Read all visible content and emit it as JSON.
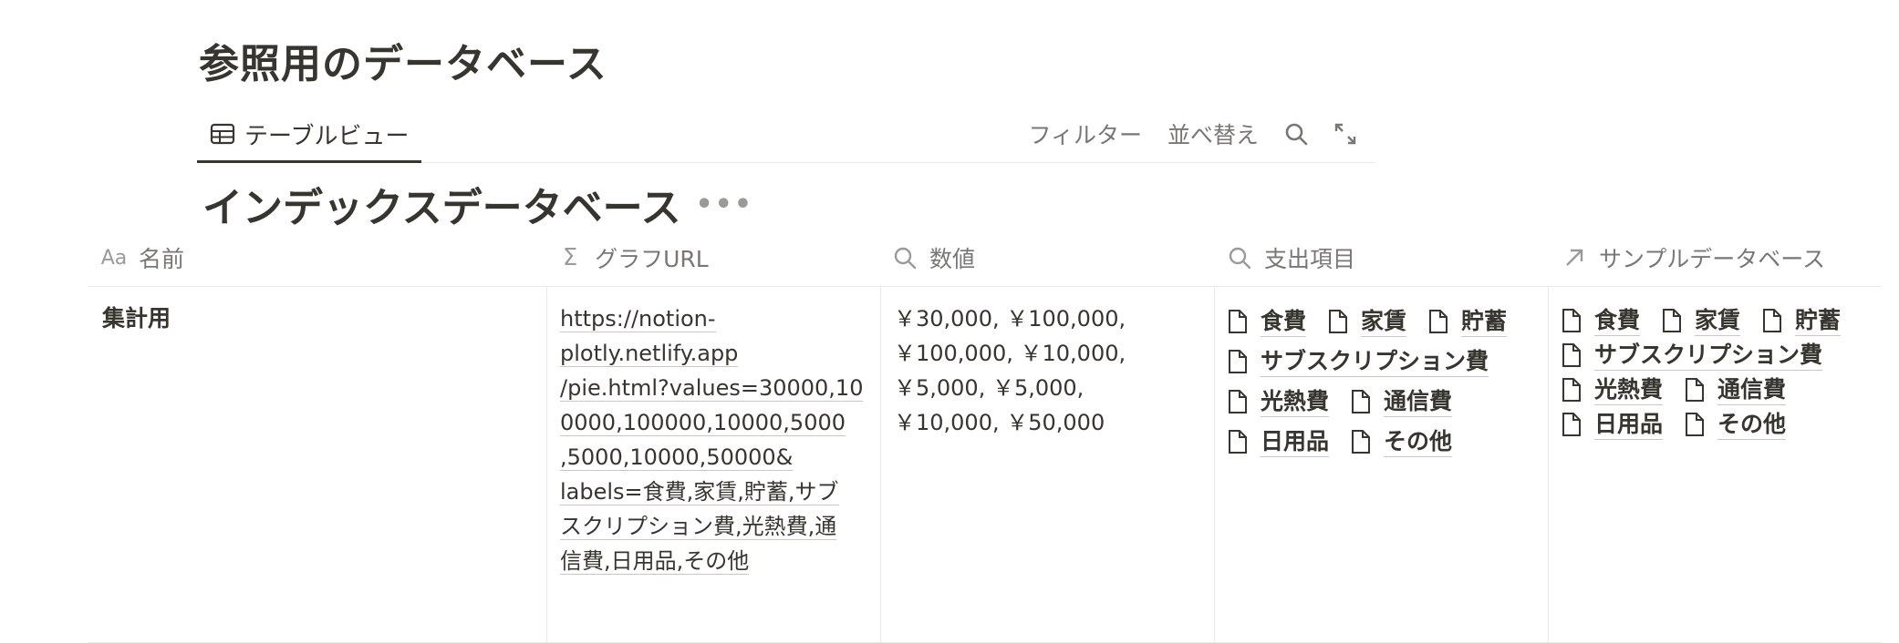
{
  "page": {
    "title": "参照用のデータベース"
  },
  "view": {
    "tab_label": "テーブルビュー",
    "filter_label": "フィルター",
    "sort_label": "並べ替え"
  },
  "database": {
    "title": "インデックスデータベース",
    "more": "•••",
    "columns": [
      {
        "label": "名前",
        "icon": "Aa"
      },
      {
        "label": "グラフURL",
        "icon": "Σ"
      },
      {
        "label": "数値",
        "icon": "search-icon"
      },
      {
        "label": "支出項目",
        "icon": "search-icon"
      },
      {
        "label": "サンプルデータベース",
        "icon": "arrow-up-right-icon"
      }
    ],
    "rows": [
      {
        "name": "集計用",
        "url_lines": [
          "https://notion-",
          "plotly.netlify.app",
          "/pie.html?values=30000,10",
          "0000,100000,10000,5000",
          ",5000,10000,50000&",
          "labels=食費,家賃,貯蓄,サブ",
          "スクリプション費,光熱費,通",
          "信費,日用品,その他"
        ],
        "value_lines": [
          "￥30,000, ￥100,000,",
          "￥100,000, ￥10,000,",
          "￥5,000, ￥5,000,",
          "￥10,000, ￥50,000"
        ],
        "expense_items": [
          "食費",
          "家賃",
          "貯蓄",
          "サブスクリプション費",
          "光熱費",
          "通信費",
          "日用品",
          "その他"
        ],
        "sample_items": [
          "食費",
          "家賃",
          "貯蓄",
          "サブスクリプション費",
          "光熱費",
          "通信費",
          "日用品",
          "その他"
        ]
      }
    ]
  }
}
